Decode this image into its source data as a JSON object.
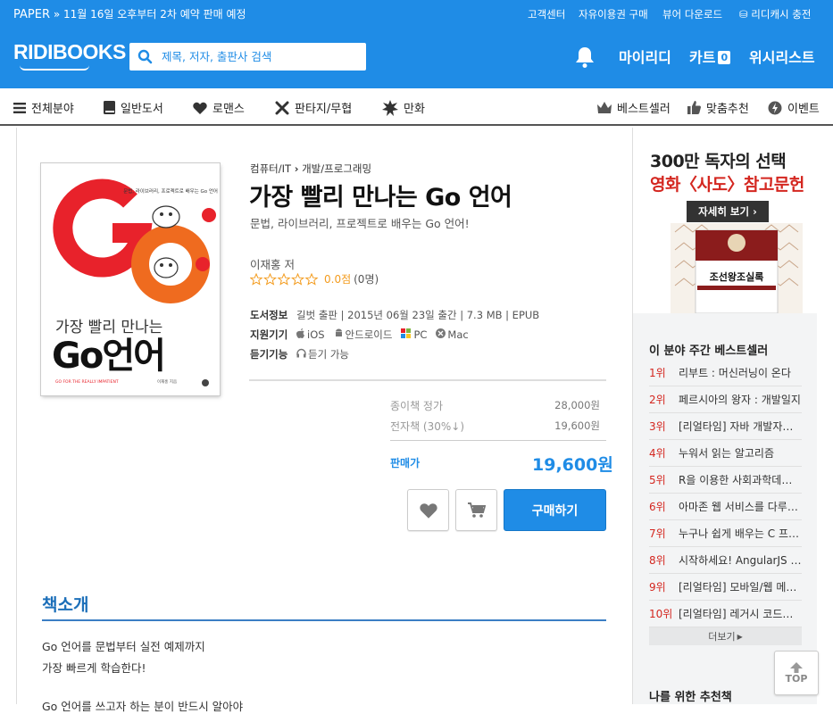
{
  "topbar": {
    "paper": "PAPER",
    "notice": "11월 16일 오후부터 2차 예약 판매 예정",
    "links": [
      "고객센터",
      "자유이용권 구매",
      "뷰어 다운로드"
    ],
    "charge": "리디캐시 충전"
  },
  "header": {
    "logo": "RIDIBOOKS",
    "search_placeholder": "제목, 저자, 출판사 검색",
    "my": "마이리디",
    "cart": "카트",
    "cart_count": "0",
    "wishlist": "위시리스트"
  },
  "nav": {
    "left": [
      "전체분야",
      "일반도서",
      "로맨스",
      "판타지/무협",
      "만화"
    ],
    "right": [
      "베스트셀러",
      "맞춤추천",
      "이벤트"
    ]
  },
  "book": {
    "category": "컴퓨터/IT",
    "subcategory": "개발/프로그래밍",
    "title": "가장 빨리 만나는 Go 언어",
    "subtitle": "문법, 라이브러리, 프로젝트로 배우는 Go 언어!",
    "author": "이재홍 저",
    "rating": "0.0점",
    "rating_count": "(0명)",
    "info_label": "도서정보",
    "info_value": "길벗 출판 | 2015년 06월 23일 출간 | 7.3 MB | EPUB",
    "device_label": "지원기기",
    "devices": [
      "iOS",
      "안드로이드",
      "PC",
      "Mac"
    ],
    "listen_label": "듣기기능",
    "listen_value": "듣기 가능",
    "paper_price_label": "종이책 정가",
    "paper_price": "28,000원",
    "ebook_price_label": "전자책 (30%↓)",
    "ebook_price": "19,600원",
    "sale_label": "판매가",
    "sale_price": "19,600원",
    "buy_label": "구매하기",
    "cover": {
      "tagline": "문법, 라이브러리, 프로젝트로 배우는 Go 언어",
      "title_top": "가장 빨리 만나는",
      "title_big": "Go언어",
      "footer": "GO FOR THE REALLY IMPATIENT",
      "author": "이재홍 지음"
    }
  },
  "intro": {
    "heading": "책소개",
    "lines": [
      "Go 언어를 문법부터 실전 예제까지",
      "가장 빠르게 학습한다!",
      "Go 언어를 쓰고자 하는 분이 반드시 알아야"
    ]
  },
  "sidebar": {
    "ad_line1": "300만 독자의 선택",
    "ad_line2": "영화〈사도〉참고문헌",
    "ad_button": "자세히 보기",
    "ad_book_title": "조선왕조실록",
    "bestseller_title": "이 분야 주간 베스트셀러",
    "bestsellers": [
      {
        "rank": "1위",
        "title": "리부트 : 머신러닝이 온다"
      },
      {
        "rank": "2위",
        "title": "페르시아의 왕자 : 개발일지"
      },
      {
        "rank": "3위",
        "title": "[리얼타임] 자바 개발자를 위한..."
      },
      {
        "rank": "4위",
        "title": "누워서 읽는 알고리즘"
      },
      {
        "rank": "5위",
        "title": "R을 이용한 사회과학데이터..."
      },
      {
        "rank": "6위",
        "title": "아마존 웹 서비스를 다루는..."
      },
      {
        "rank": "7위",
        "title": "누구나 쉽게 배우는 C 프로그..."
      },
      {
        "rank": "8위",
        "title": "시작하세요! AngularJS 프로그..."
      },
      {
        "rank": "9위",
        "title": "[리얼타임] 모바일/웹 메시징"
      },
      {
        "rank": "10위",
        "title": "[리얼타임] 레거시 코드를 ..."
      }
    ],
    "more": "더보기",
    "recommend_title": "나를 위한 추천책"
  },
  "top_button": "TOP",
  "colors": {
    "brand": "#1f8ce6",
    "rank": "#d42720",
    "go_red": "#e8222b",
    "go_orange": "#ef6b1f"
  }
}
